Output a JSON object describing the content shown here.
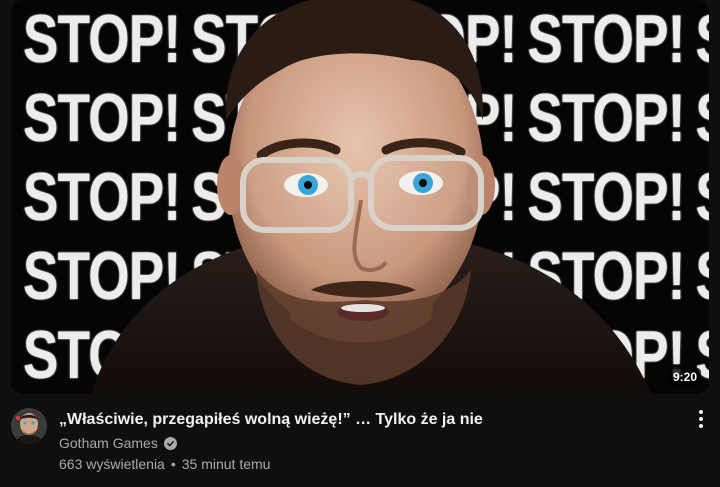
{
  "thumbnail": {
    "background_text": "STOP!",
    "duration": "9:20"
  },
  "video": {
    "title": "„Właściwie, przegapiłeś wolną wieżę!” … Tylko że ja nie",
    "channel": "Gotham Games",
    "views": "663 wyświetlenia",
    "separator": "•",
    "age": "35 minut temu"
  },
  "icons": {
    "verified": "verified-check-icon",
    "more": "more-vert-icon"
  },
  "colors": {
    "background": "#0f0f0f",
    "title": "#f1f1f1",
    "secondary_text": "#aaaaaa"
  }
}
